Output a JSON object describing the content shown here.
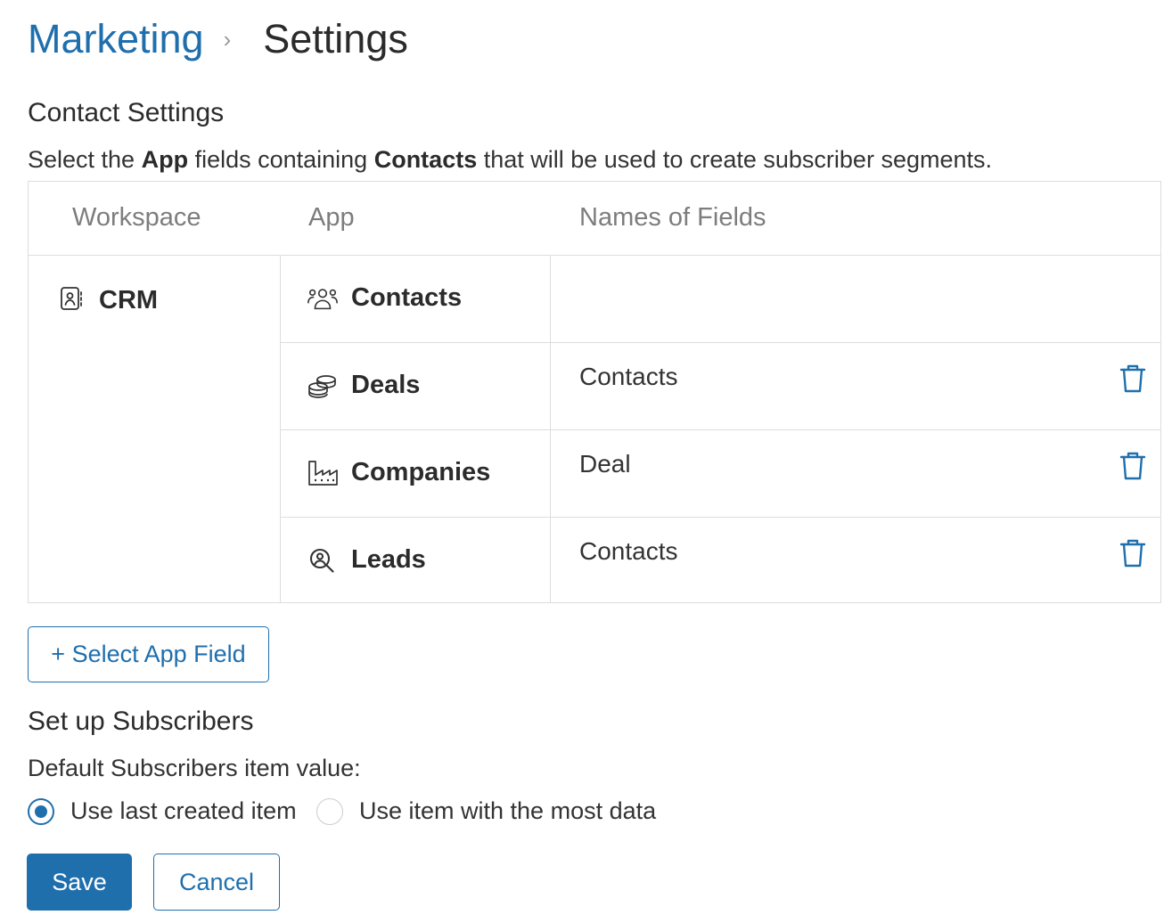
{
  "breadcrumb": {
    "parent": "Marketing",
    "separator": "›",
    "current": "Settings"
  },
  "contact_settings": {
    "title": "Contact Settings",
    "description_parts": [
      "Select the ",
      "App",
      " fields containing ",
      "Contacts",
      " that will be used to create subscriber segments."
    ],
    "table": {
      "headers": {
        "workspace": "Workspace",
        "app": "App",
        "fields": "Names of Fields"
      },
      "workspace": {
        "name": "CRM",
        "icon": "contact-book-icon"
      },
      "rows": [
        {
          "app": "Contacts",
          "icon": "people-icon",
          "field": ""
        },
        {
          "app": "Deals",
          "icon": "coins-icon",
          "field": "Contacts"
        },
        {
          "app": "Companies",
          "icon": "factory-icon",
          "field": "Deal"
        },
        {
          "app": "Leads",
          "icon": "search-person-icon",
          "field": "Contacts"
        }
      ]
    },
    "select_button": "+ Select App Field"
  },
  "subscribers": {
    "title": "Set up Subscribers",
    "label": "Default Subscribers item value:",
    "options": [
      {
        "label": "Use last created item",
        "selected": true
      },
      {
        "label": "Use item with the most data",
        "selected": false
      }
    ]
  },
  "actions": {
    "save": "Save",
    "cancel": "Cancel"
  },
  "colors": {
    "accent": "#1f6fad",
    "border": "#dddddd",
    "header_text": "#7d7d7d"
  }
}
